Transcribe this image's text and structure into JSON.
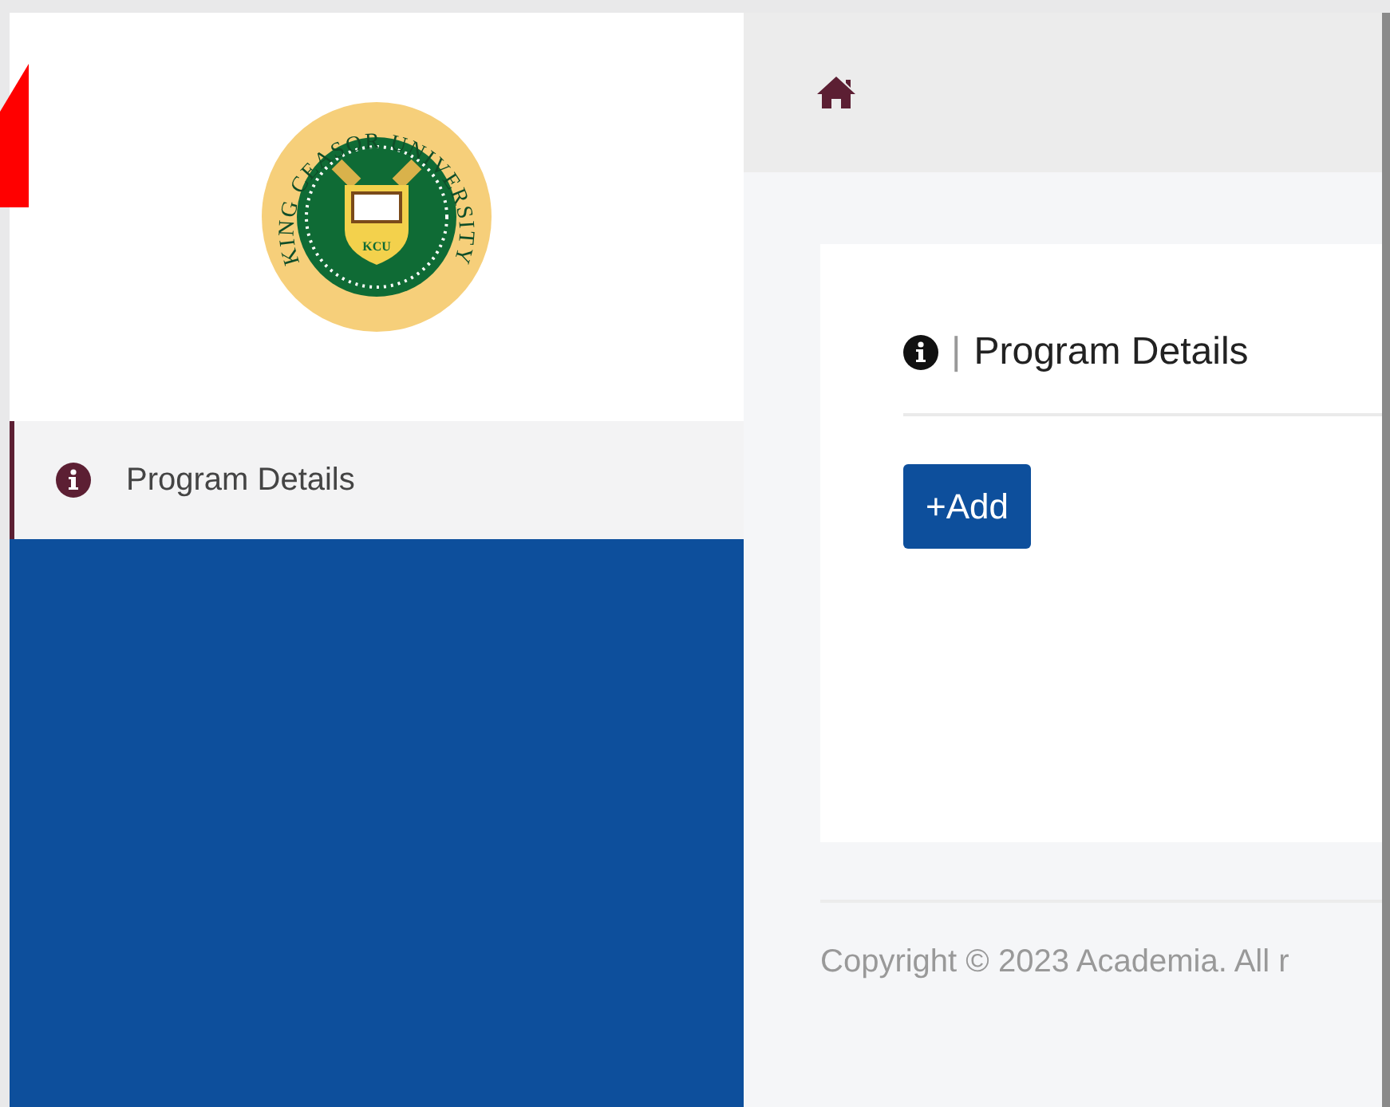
{
  "logo": {
    "ring_text": "KING CEASOR UNIVERSITY",
    "initials": "KCU"
  },
  "sidebar": {
    "items": [
      {
        "label": "Program Details",
        "selected": true
      }
    ]
  },
  "card": {
    "title": "Program Details",
    "separator": "|",
    "buttons": [
      "+Add"
    ]
  },
  "footer": {
    "text": "Copyright © 2023 Academia. All r"
  }
}
